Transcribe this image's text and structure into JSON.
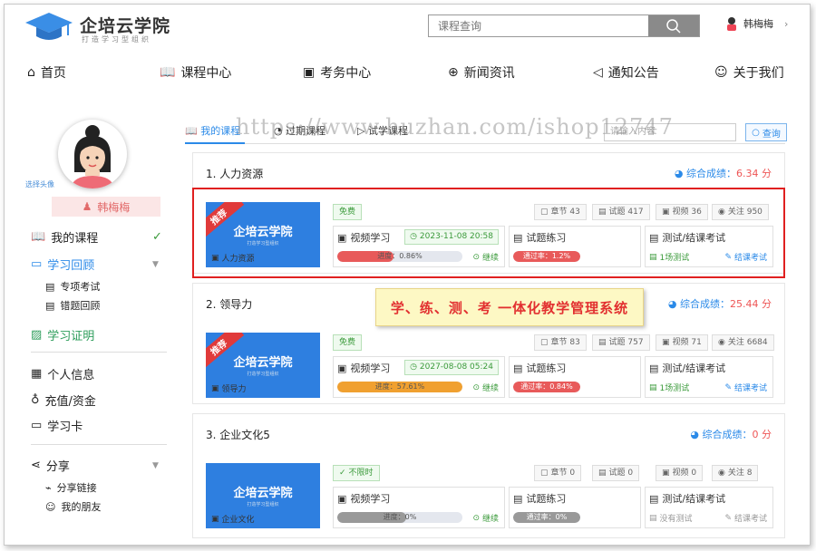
{
  "brand": {
    "name": "企培云学院",
    "slogan": "打造学习型组织"
  },
  "search": {
    "placeholder": "课程查询"
  },
  "user": {
    "name": "韩梅梅"
  },
  "nav": [
    {
      "label": "首页"
    },
    {
      "label": "课程中心"
    },
    {
      "label": "考务中心"
    },
    {
      "label": "新闻资讯"
    },
    {
      "label": "通知公告"
    },
    {
      "label": "关于我们"
    }
  ],
  "sidebar": {
    "select_avatar": "选择头像",
    "username": "韩梅梅",
    "items": [
      {
        "label": "我的课程"
      },
      {
        "label": "学习回顾"
      },
      {
        "label": "专项考试"
      },
      {
        "label": "错题回顾"
      },
      {
        "label": "学习证明"
      },
      {
        "label": "个人信息"
      },
      {
        "label": "充值/资金"
      },
      {
        "label": "学习卡"
      },
      {
        "label": "分享"
      },
      {
        "label": "分享链接"
      },
      {
        "label": "我的朋友"
      }
    ]
  },
  "tabs": [
    {
      "label": "我的课程"
    },
    {
      "label": "过期课程"
    },
    {
      "label": "试学课程"
    }
  ],
  "filter": {
    "placeholder": "请输入内容",
    "button": "查询"
  },
  "watermark": "https://www.huzhan.com/ishop12747",
  "banner": "学、练、测、考 一体化教学管理系统",
  "cards": [
    {
      "title": "1. 人力资源",
      "score_label": "综合成绩：",
      "score": "6.34 分",
      "thumb_label": "人力资源",
      "ribbon": "推荐",
      "tag": "免费",
      "stats": [
        "章节 43",
        "试题 417",
        "视频 36",
        "关注 950"
      ],
      "video": {
        "title": "视频学习",
        "date": "2023-11-08 20:58",
        "progress_text": "进度：0.86%",
        "progress": 0.0086,
        "action": "继续"
      },
      "practice": {
        "title": "试题练习",
        "pass_text": "通过率：1.2%",
        "pass": 0.012
      },
      "exam": {
        "title": "测试/结课考试",
        "left": "1场测试",
        "right": "结课考试"
      }
    },
    {
      "title": "2. 领导力",
      "score_label": "综合成绩：",
      "score": "25.44 分",
      "thumb_label": "领导力",
      "ribbon": "推荐",
      "tag": "免费",
      "stats": [
        "章节 83",
        "试题 757",
        "视频 71",
        "关注 6684"
      ],
      "video": {
        "title": "视频学习",
        "date": "2027-08-08 05:24",
        "progress_text": "进度：57.61%",
        "progress": 0.5761,
        "action": "继续"
      },
      "practice": {
        "title": "试题练习",
        "pass_text": "通过率：0.84%",
        "pass": 0.0084
      },
      "exam": {
        "title": "测试/结课考试",
        "left": "1场测试",
        "right": "结课考试"
      }
    },
    {
      "title": "3. 企业文化5",
      "score_label": "综合成绩：",
      "score": "0 分",
      "thumb_label": "企业文化",
      "ribbon": "",
      "tag": "不限时",
      "stats": [
        "章节 0",
        "试题 0",
        "视频 0",
        "关注 8"
      ],
      "video": {
        "title": "视频学习",
        "date": "",
        "progress_text": "进度：0%",
        "progress": 0,
        "action": "继续"
      },
      "practice": {
        "title": "试题练习",
        "pass_text": "通过率：0%",
        "pass": 0
      },
      "exam": {
        "title": "测试/结课考试",
        "left": "没有测试",
        "right": "结课考试"
      }
    }
  ],
  "colors": {
    "accent": "#2b8ae8",
    "danger": "#e02020",
    "progress_warn": "#f0a030",
    "progress_low": "#e85a5a"
  }
}
